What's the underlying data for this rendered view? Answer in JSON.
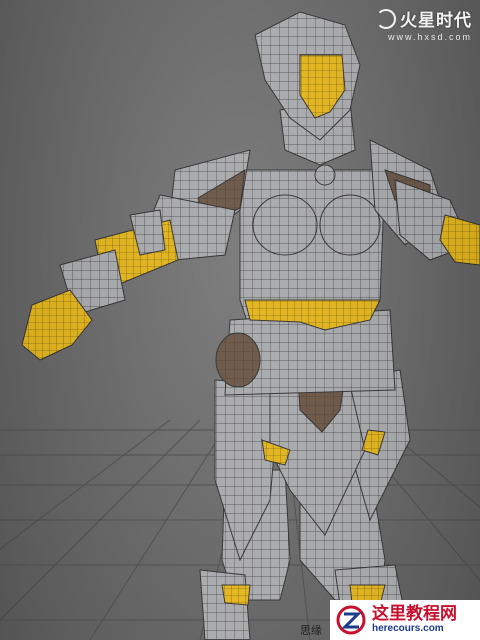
{
  "watermark_top": {
    "logo_text": "火星时代",
    "url": "www.hxsd.com"
  },
  "watermark_bottom": {
    "site_name": "这里教程网",
    "url": "herecours.com",
    "partial_text": "思缘"
  },
  "viewport": {
    "background": "#6b6b6b",
    "grid_color": "#4a4a4a",
    "armor_color": "#a9aaad",
    "wire_color": "#3a3a3a",
    "skin_color": "#e8b81e",
    "leather_color": "#6e5a48"
  }
}
